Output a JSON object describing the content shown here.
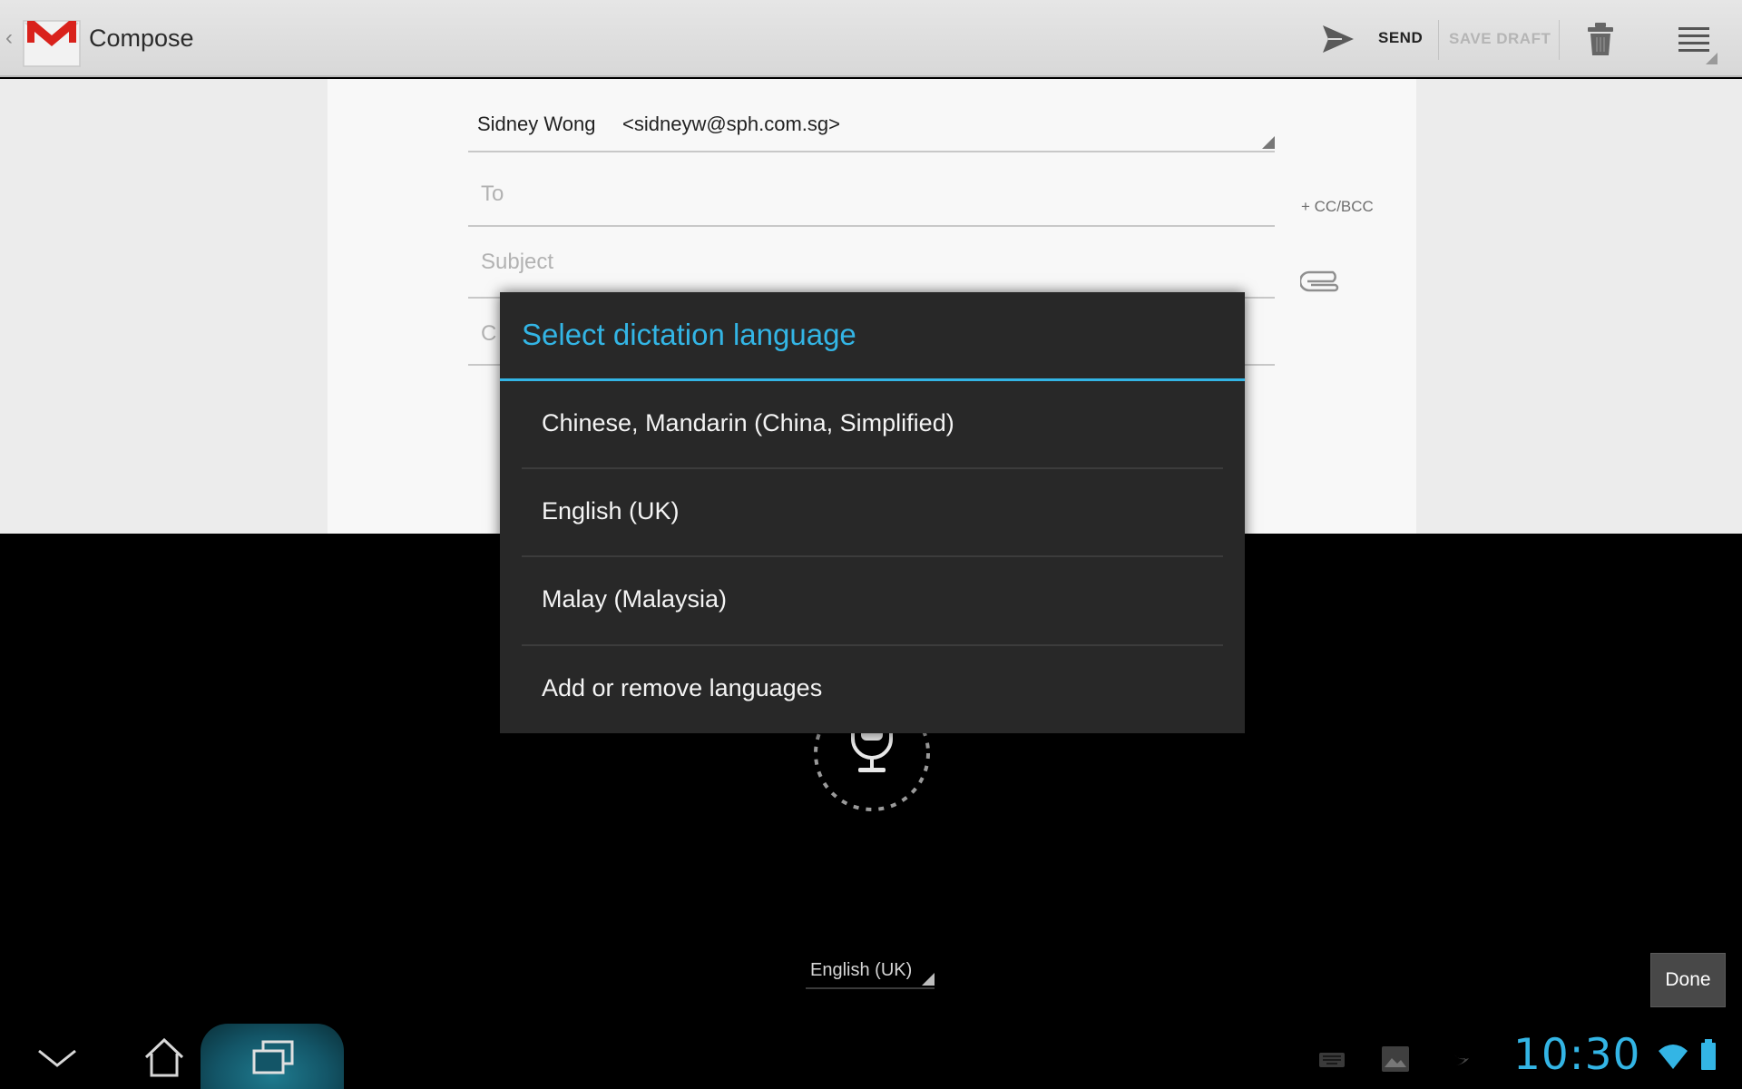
{
  "actionbar": {
    "title": "Compose",
    "send_label": "SEND",
    "save_draft_label": "SAVE DRAFT",
    "icons": [
      "back-chevron-icon",
      "gmail-logo-icon",
      "send-icon",
      "trash-icon",
      "overflow-menu-icon"
    ]
  },
  "compose": {
    "from_name": "Sidney Wong",
    "from_email": "<sidneyw@sph.com.sg>",
    "to_placeholder": "To",
    "subject_placeholder": "Subject",
    "body_placeholder": "C",
    "cc_bcc_label": "+ CC/BCC"
  },
  "dialog": {
    "title": "Select dictation language",
    "options": [
      {
        "label": "Chinese, Mandarin (China, Simplified)"
      },
      {
        "label": "English (UK)"
      },
      {
        "label": "Malay (Malaysia)"
      },
      {
        "label": "Add or remove languages"
      }
    ]
  },
  "voice_input": {
    "language": "English (UK)",
    "done_label": "Done"
  },
  "status_bar": {
    "time": "10:30",
    "accent_color": "#33b5e5"
  }
}
